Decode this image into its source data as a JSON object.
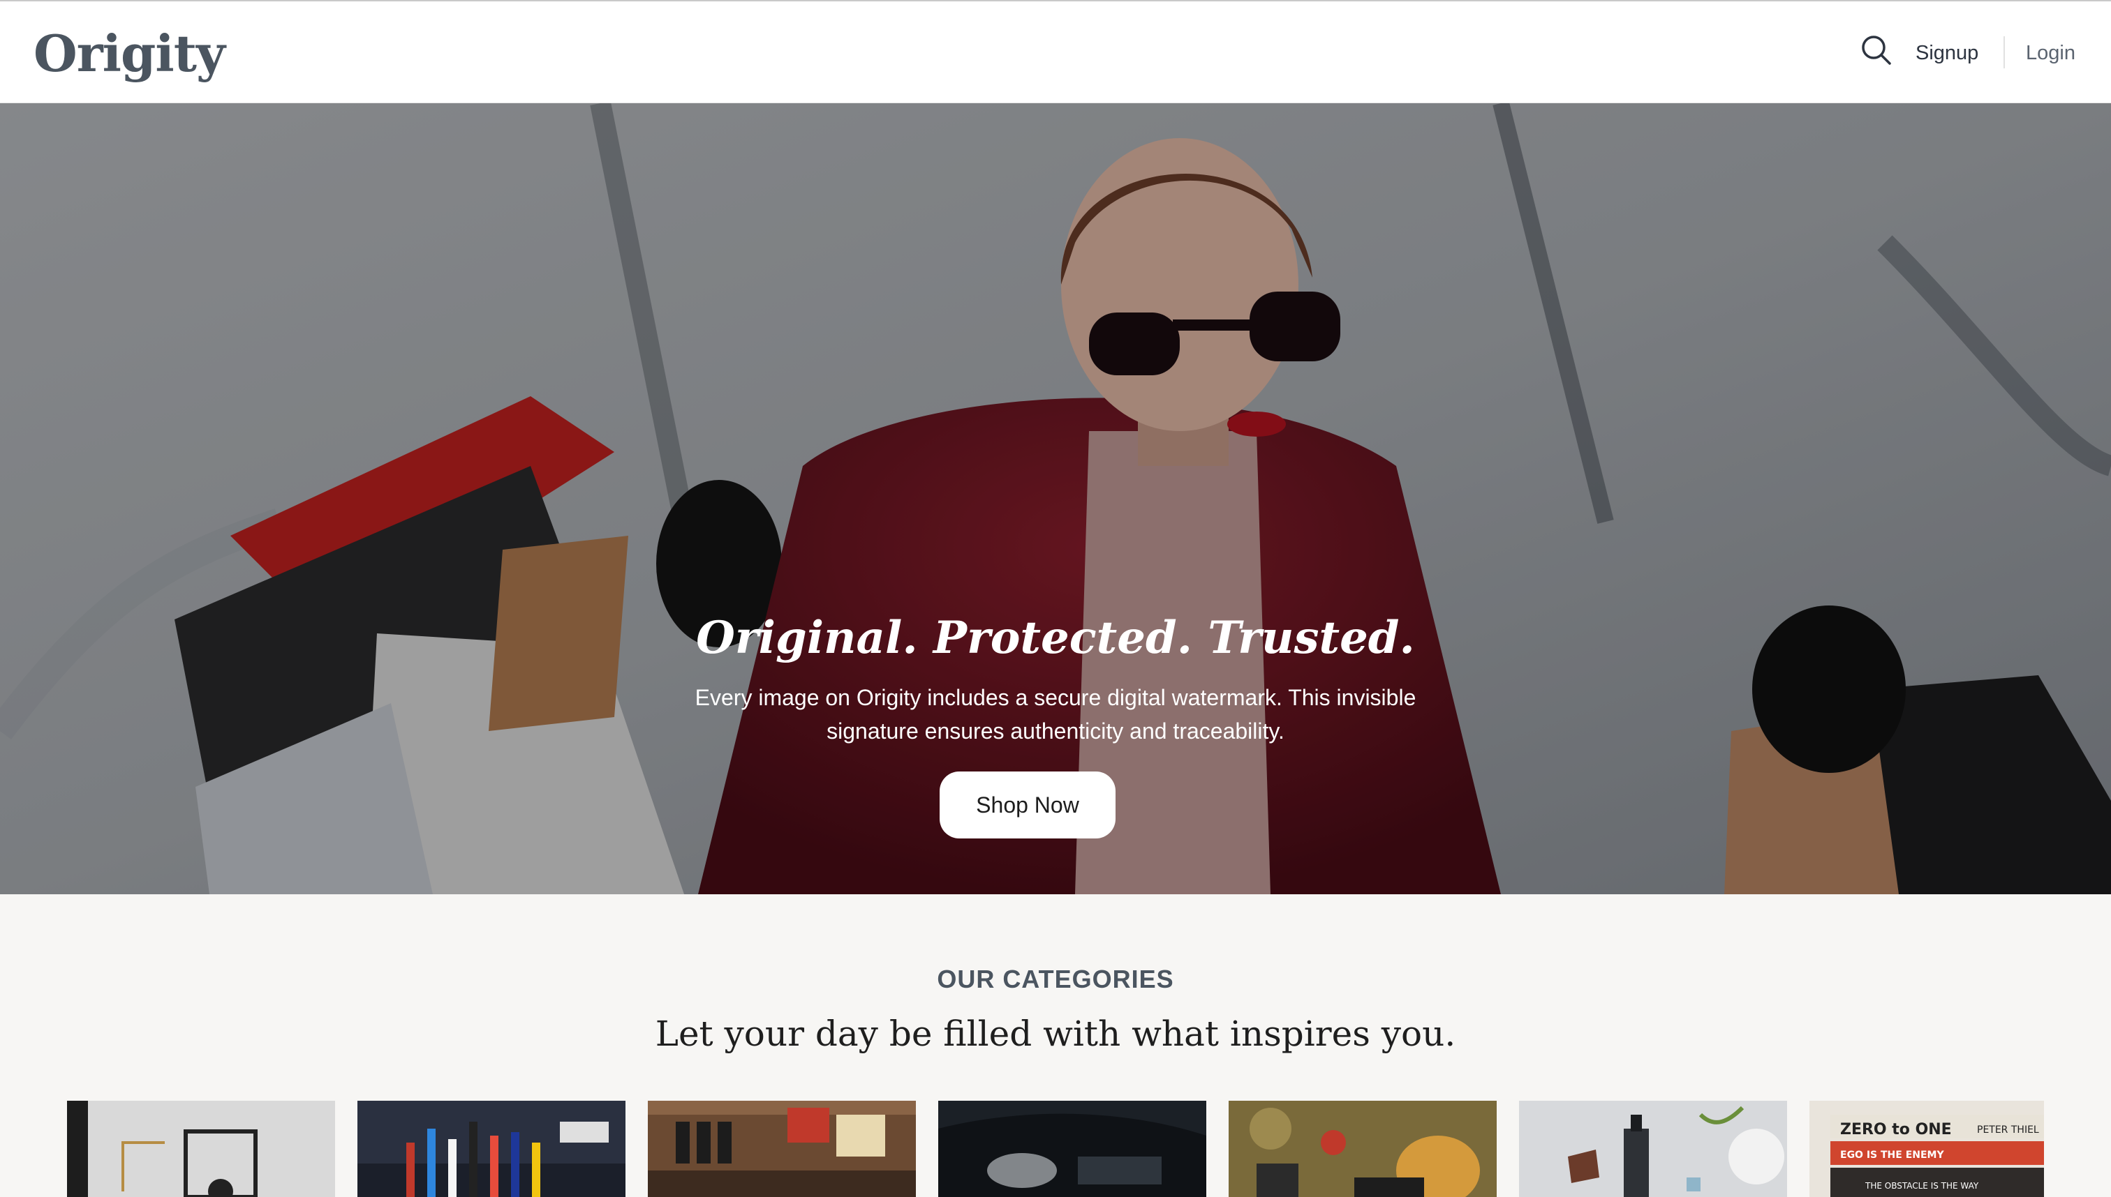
{
  "header": {
    "logo": "Origity",
    "signup_label": "Signup",
    "login_label": "Login",
    "search_icon": "search-icon"
  },
  "hero": {
    "title": "Original. Protected. Trusted.",
    "description": "Every image on Origity includes a secure digital watermark. This invisible signature ensures authenticity and traceability.",
    "cta_label": "Shop Now",
    "image": "woman-with-shopping-bags"
  },
  "categories": {
    "eyebrow": "OUR CATEGORIES",
    "heading": "Let your day be filled with what inspires you.",
    "cards": [
      {
        "image": "interior-decor"
      },
      {
        "image": "stationery-pens"
      },
      {
        "image": "grocery-shelves"
      },
      {
        "image": "car-engine"
      },
      {
        "image": "toys-games"
      },
      {
        "image": "skincare-products"
      },
      {
        "image": "books",
        "book_titles": [
          "ZERO to ONE",
          "PETER THIEL",
          "EGO IS THE ENEMY",
          "THE OBSTACLE IS THE WAY"
        ]
      }
    ]
  },
  "colors": {
    "logo": "#4b5560",
    "background": "#f7f6f4",
    "header": "#ffffff",
    "button": "#ffffff"
  }
}
